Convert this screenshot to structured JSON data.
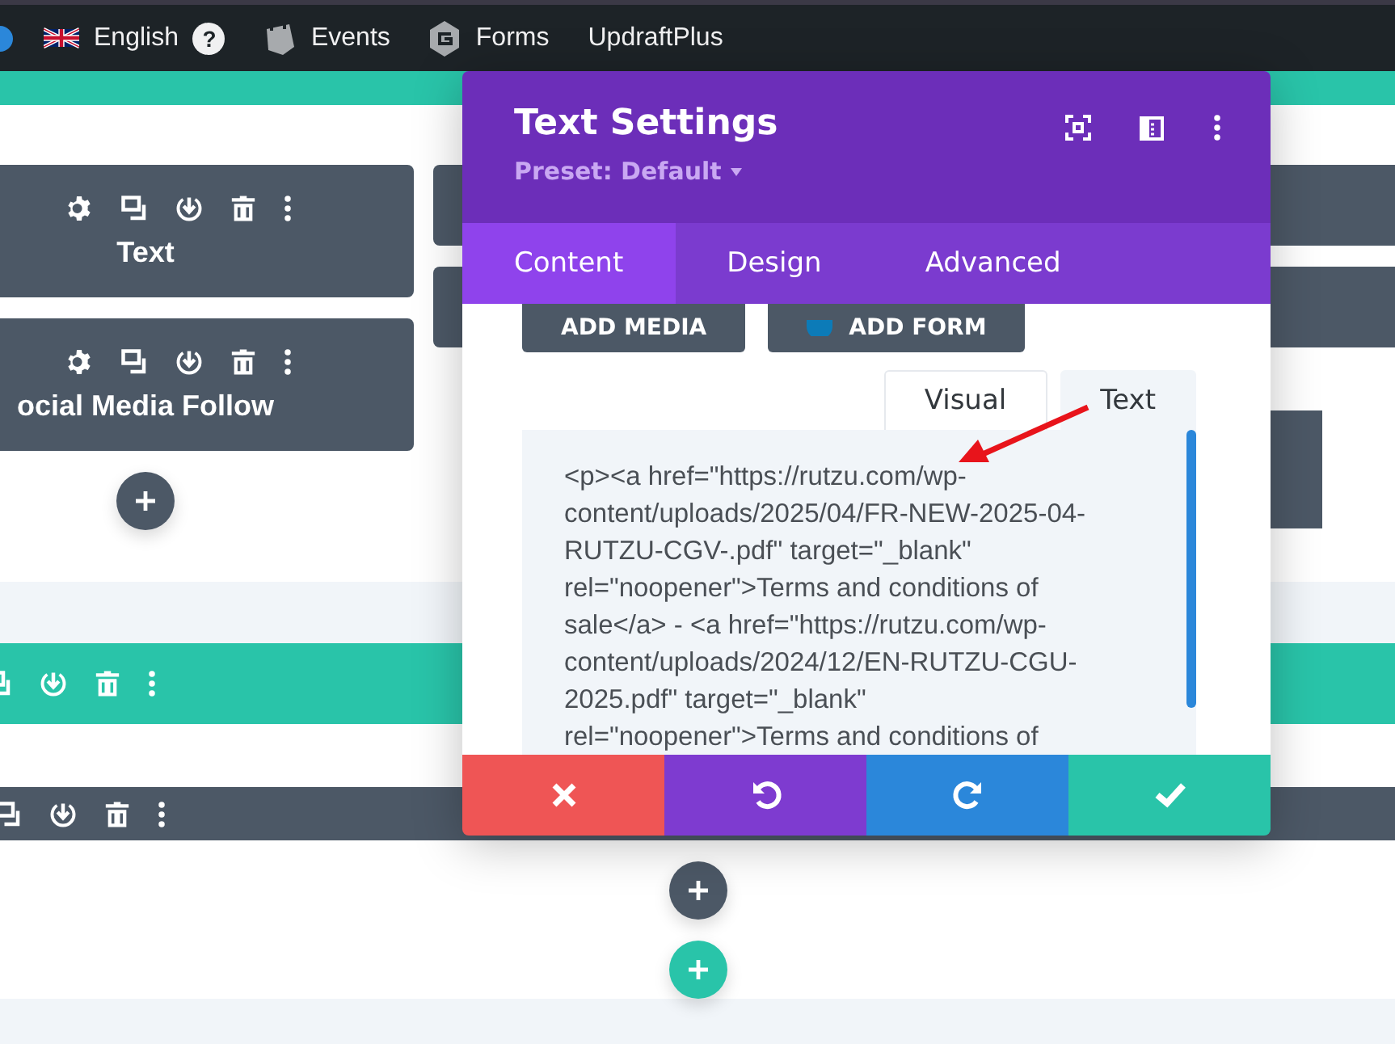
{
  "admin_bar": {
    "items": [
      {
        "kind": "language",
        "label": "English",
        "help": "?"
      },
      {
        "kind": "events",
        "label": "Events"
      },
      {
        "kind": "forms",
        "label": "Forms"
      },
      {
        "kind": "plain",
        "label": "UpdraftPlus"
      }
    ]
  },
  "modules": [
    {
      "label": "Text"
    },
    {
      "label": "ocial Media Follow"
    }
  ],
  "modal": {
    "title": "Text Settings",
    "preset": "Preset: Default",
    "tabs": [
      {
        "label": "Content",
        "selected": true
      },
      {
        "label": "Design",
        "selected": false
      },
      {
        "label": "Advanced",
        "selected": false
      }
    ],
    "media_buttons": [
      {
        "kind": "media",
        "label": "ADD MEDIA"
      },
      {
        "kind": "form",
        "label": "ADD FORM"
      }
    ],
    "editor_tabs": [
      {
        "label": "Visual",
        "selected": false
      },
      {
        "label": "Text",
        "selected": true
      }
    ],
    "editor_text": "<p><a href=\"https://rutzu.com/wp-content/uploads/2025/04/FR-NEW-2025-04-RUTZU-CGV-.pdf\" target=\"_blank\" rel=\"noopener\">Terms and conditions of sale</a> - <a href=\"https://rutzu.com/wp-content/uploads/2024/12/EN-RUTZU-CGU-2025.pdf\" target=\"_blank\" rel=\"noopener\">Terms and conditions of",
    "footer": [
      {
        "kind": "cancel"
      },
      {
        "kind": "undo"
      },
      {
        "kind": "redo"
      },
      {
        "kind": "save"
      }
    ]
  }
}
